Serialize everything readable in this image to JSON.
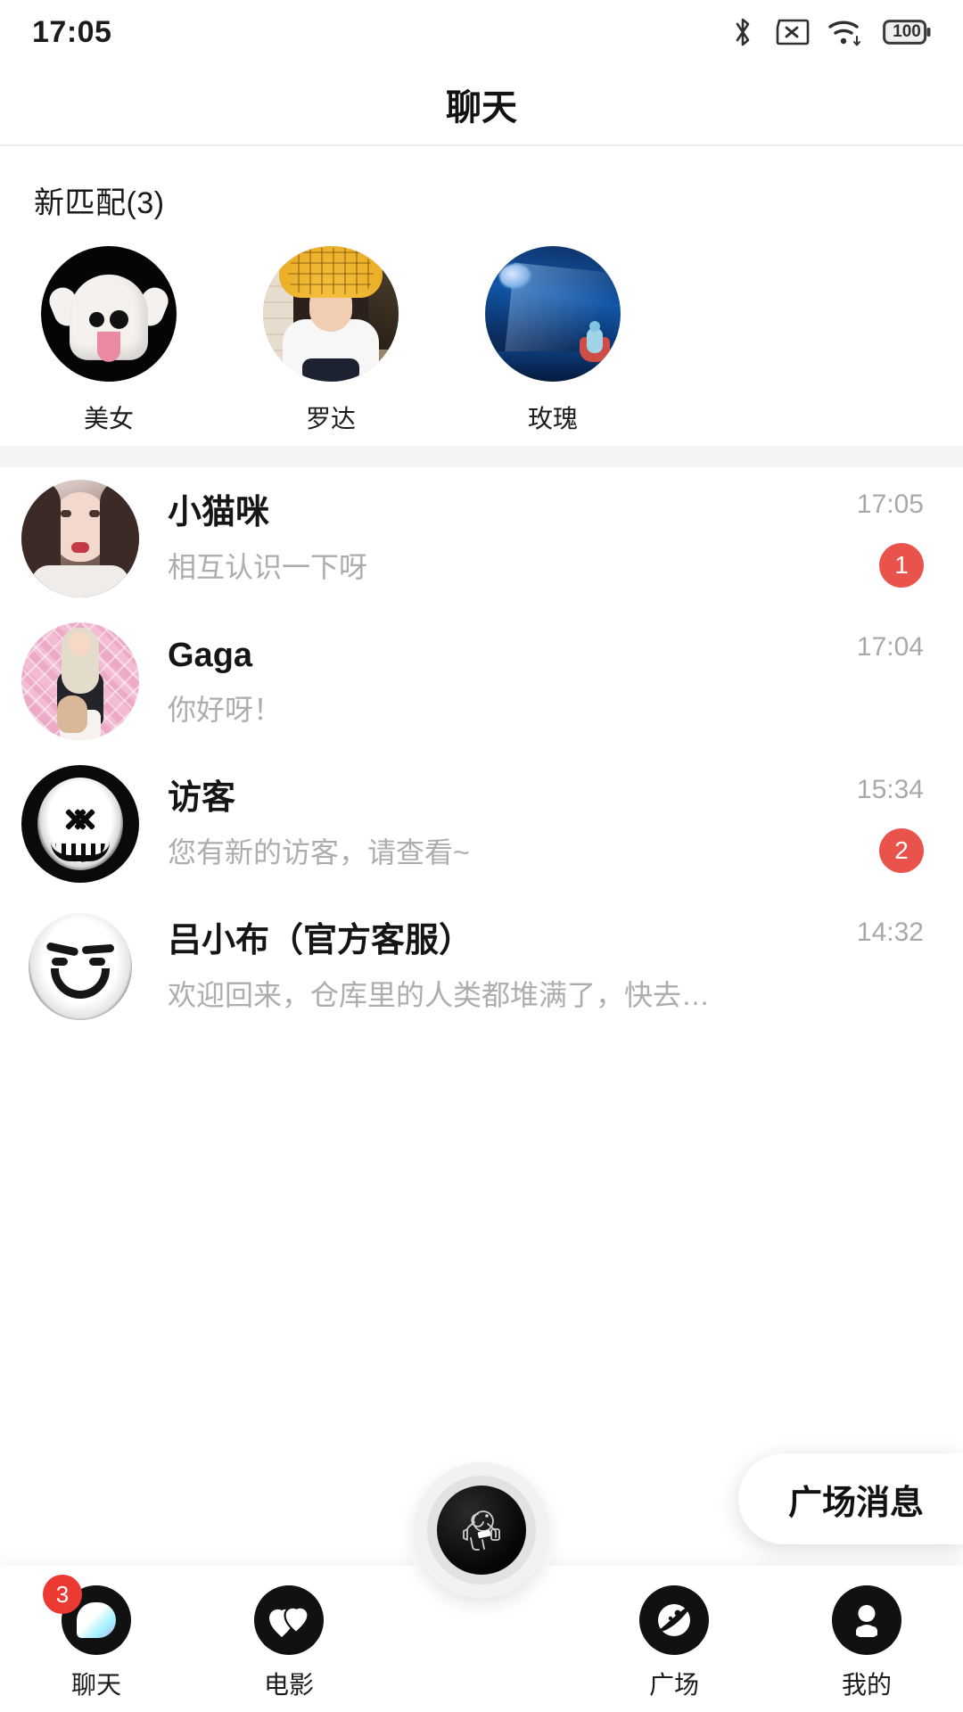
{
  "status_bar": {
    "time": "17:05",
    "battery_level": "100",
    "icons": [
      "bluetooth-icon",
      "sim-card-off-icon",
      "wifi-icon",
      "battery-icon"
    ]
  },
  "header": {
    "title": "聊天"
  },
  "new_matches": {
    "section_title": "新匹配(3)",
    "count": 3,
    "items": [
      {
        "name": "美女",
        "avatar": "ghost-avatar"
      },
      {
        "name": "罗达",
        "avatar": "girl-photo-avatar"
      },
      {
        "name": "玫瑰",
        "avatar": "night-scene-avatar"
      }
    ]
  },
  "chats": [
    {
      "name": "小猫咪",
      "message": "相互认识一下呀",
      "time": "17:05",
      "badge": "1",
      "avatar": "woman-portrait-avatar"
    },
    {
      "name": "Gaga",
      "message": "你好呀！",
      "time": "17:04",
      "badge": "",
      "avatar": "pink-fence-portrait-avatar"
    },
    {
      "name": "访客",
      "message": "您有新的访客，请查看~",
      "time": "15:34",
      "badge": "2",
      "avatar": "x-eyes-mask-avatar"
    },
    {
      "name": "吕小布（官方客服）",
      "message": "欢迎回来，仓库里的人类都堆满了，快去…",
      "time": "14:32",
      "badge": "",
      "avatar": "smiley-face-avatar"
    }
  ],
  "floating_button": {
    "label": "广场消息"
  },
  "tab_bar": {
    "items": [
      {
        "label": "聊天",
        "icon": "chat-bubble-icon",
        "badge": "3",
        "active": true
      },
      {
        "label": "电影",
        "icon": "double-heart-icon",
        "badge": "",
        "active": false
      },
      {
        "label": "",
        "icon": "astronaut-icon",
        "badge": "",
        "active": false
      },
      {
        "label": "广场",
        "icon": "planet-icon",
        "badge": "",
        "active": false
      },
      {
        "label": "我的",
        "icon": "person-icon",
        "badge": "",
        "active": false
      }
    ]
  },
  "colors": {
    "badge_red": "#e9534c",
    "tab_badge_red": "#ec3a33",
    "separator_gray": "#f4f4f4",
    "muted_text": "#adadad"
  }
}
